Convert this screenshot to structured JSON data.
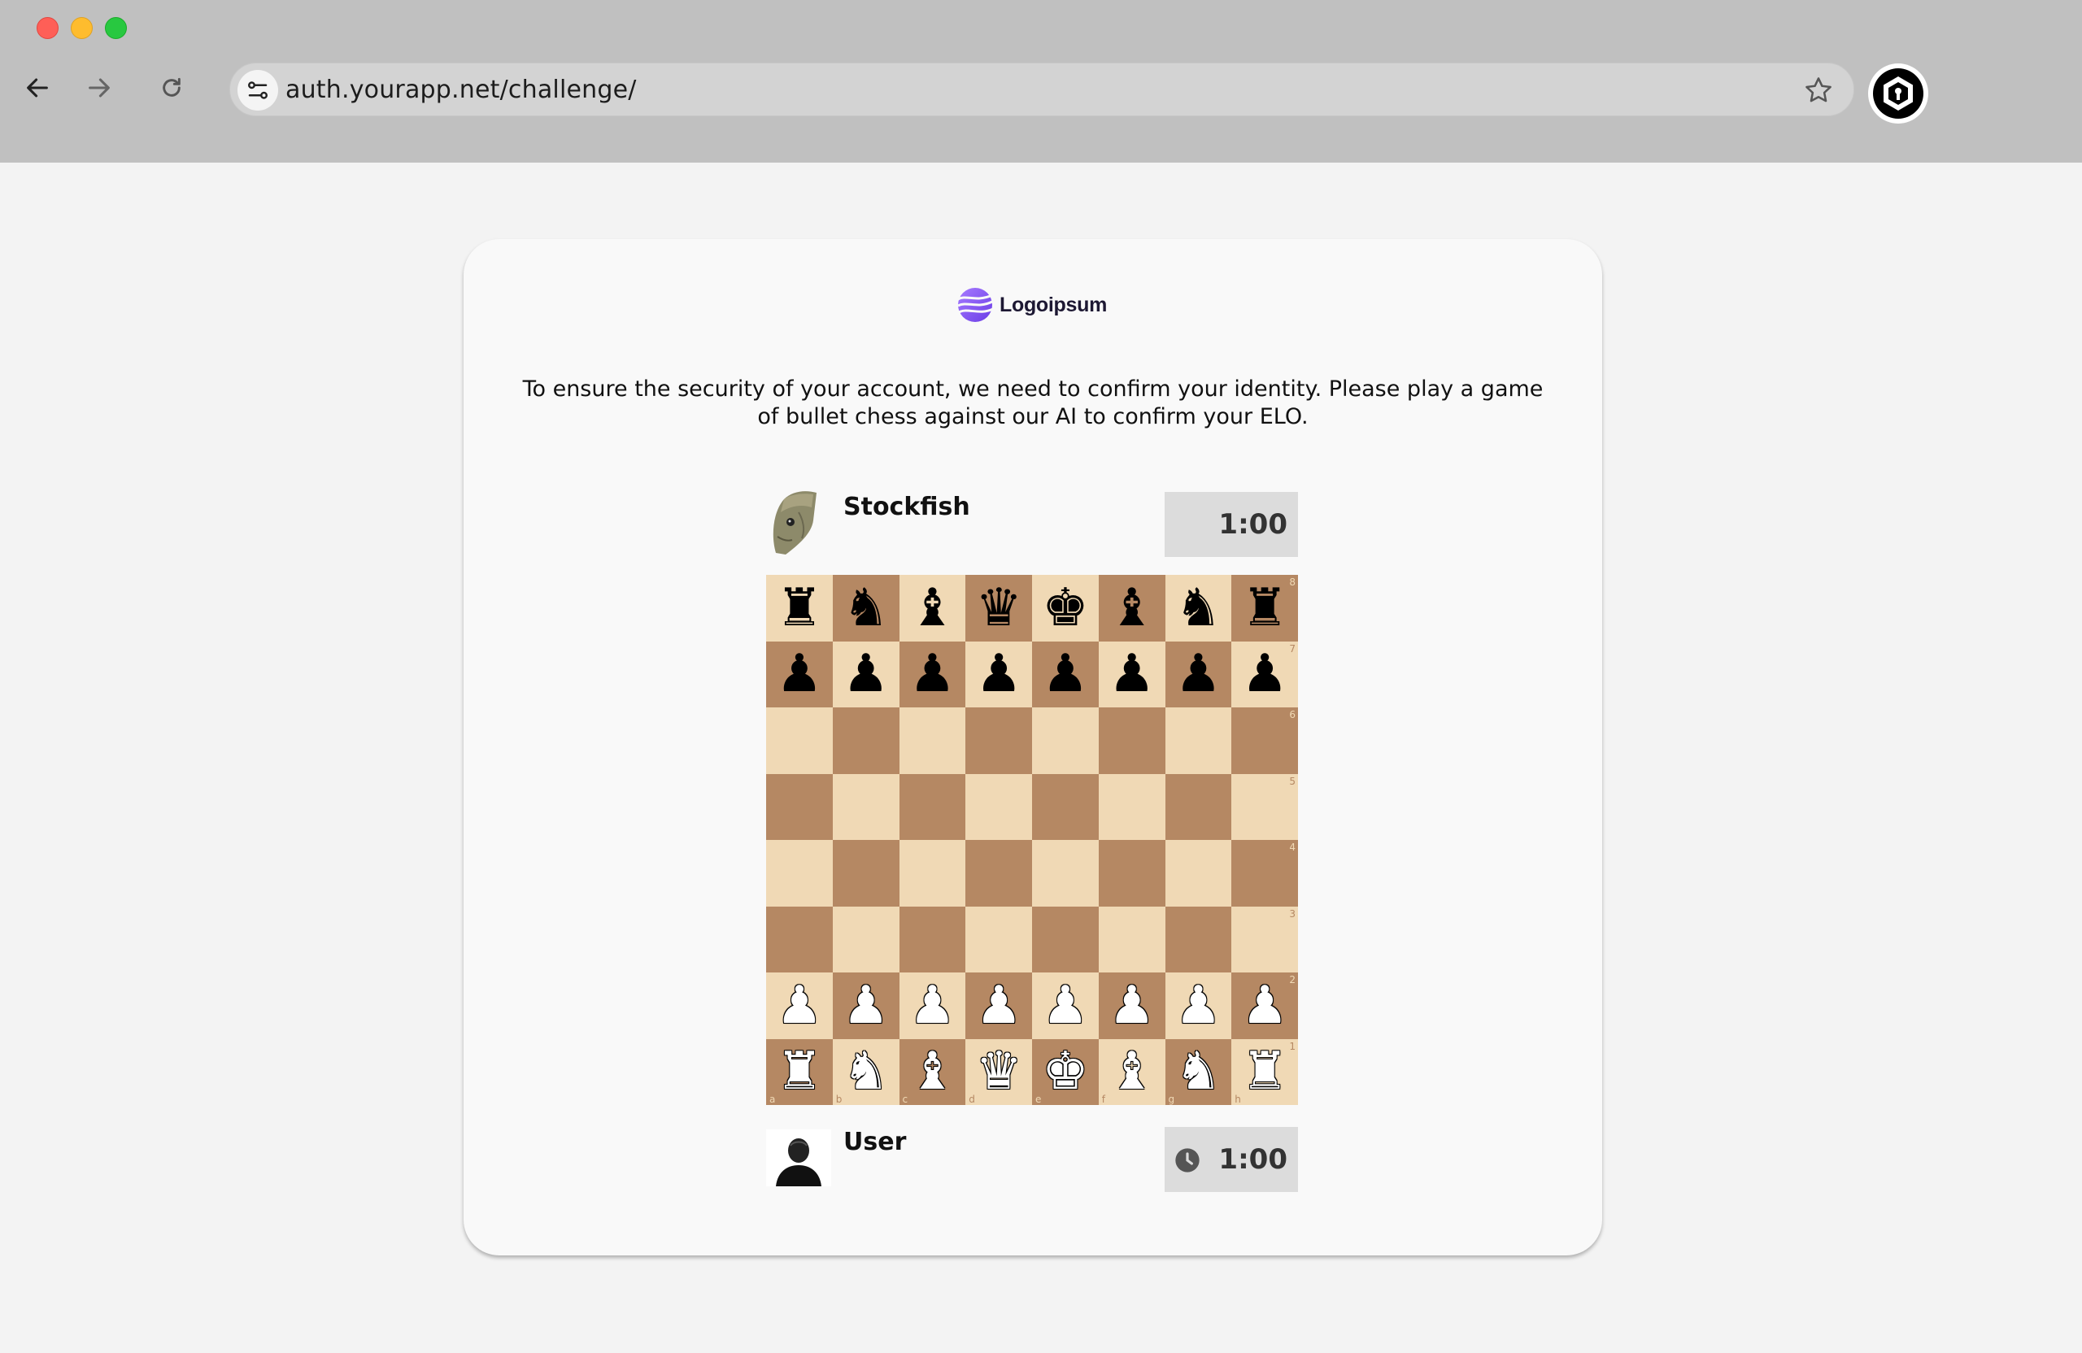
{
  "browser": {
    "url": "auth.yourapp.net/challenge/",
    "icons": [
      "back-arrow-icon",
      "forward-arrow-icon",
      "reload-icon",
      "site-settings-icon",
      "bookmark-star-icon",
      "extension-hexagon-icon"
    ]
  },
  "page": {
    "logo_text": "Logoipsum",
    "message": "To ensure the security of your account, we need to confirm your identity. Please play a game of bullet chess against our AI to confirm your ELO."
  },
  "opponent": {
    "name": "Stockfish",
    "time": "1:00",
    "avatar": "fish-avatar-icon"
  },
  "user": {
    "name": "User",
    "time": "1:00",
    "avatar": "user-silhouette-icon",
    "clock_icon": "clock-icon"
  },
  "board": {
    "light_color": "#f0d9b5",
    "dark_color": "#b58863",
    "files": [
      "a",
      "b",
      "c",
      "d",
      "e",
      "f",
      "g",
      "h"
    ],
    "ranks": [
      "8",
      "7",
      "6",
      "5",
      "4",
      "3",
      "2",
      "1"
    ],
    "position": [
      [
        "br",
        "bn",
        "bb",
        "bq",
        "bk",
        "bb",
        "bn",
        "br"
      ],
      [
        "bp",
        "bp",
        "bp",
        "bp",
        "bp",
        "bp",
        "bp",
        "bp"
      ],
      [
        "",
        "",
        "",
        "",
        "",
        "",
        "",
        ""
      ],
      [
        "",
        "",
        "",
        "",
        "",
        "",
        "",
        ""
      ],
      [
        "",
        "",
        "",
        "",
        "",
        "",
        "",
        ""
      ],
      [
        "",
        "",
        "",
        "",
        "",
        "",
        "",
        ""
      ],
      [
        "wp",
        "wp",
        "wp",
        "wp",
        "wp",
        "wp",
        "wp",
        "wp"
      ],
      [
        "wr",
        "wn",
        "wb",
        "wq",
        "wk",
        "wb",
        "wn",
        "wr"
      ]
    ]
  }
}
